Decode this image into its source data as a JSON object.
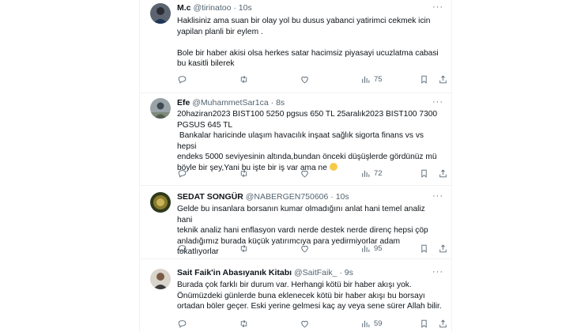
{
  "tweets": [
    {
      "name": "M.c",
      "handle": "@tirinatoo",
      "dot": "·",
      "time": "10s",
      "more": "···",
      "text": "Haklisiniz ama suan bir olay yol bu dusus yabanci yatirimci cekmek icin\nyapilan planli bir eylem .\n\nBole bir haber akisi olsa herkes satar hacimsiz piyasayi ucuzlatma cabasi\nbu kasitli bilerek",
      "views": "75"
    },
    {
      "name": "Efe",
      "handle": "@MuhammetSar1ca",
      "dot": "·",
      "time": "8s",
      "more": "···",
      "text": "20haziran2023 BIST100 5250 pgsus 650 TL 25aralık2023 BIST100 7300\nPGSUS 645 TL\n Bankalar haricinde ulaşım havacılık inşaat sağlık sigorta finans vs vs hepsi\nendeks 5000 seviyesinin altında,bundan önceki düşüşlerde gördünüz mü\nböyle bir şey,Yani bu işte bir iş var ama ne ",
      "views": "72"
    },
    {
      "name": "SEDAT SONGÜR",
      "handle": "@NABERGEN750606",
      "dot": "·",
      "time": "10s",
      "more": "···",
      "text": "Gelde bu insanlara borsanın kumar olmadığını anlat hani temel analiz hani\nteknik analiz hani enflasyon vardı nerde destek nerde direnç hepsi çöp\nanladığımız burada küçük yatırımcıya para yedirmiyorlar adam tokatlıyorlar",
      "views": "95"
    },
    {
      "name": "Sait Faik'in Abasıyanık Kitabı",
      "handle": "@SaitFaik_",
      "dot": "·",
      "time": "9s",
      "more": "···",
      "text": "Burada çok farklı bir durum var. Herhangi kötü bir haber akışı yok.\nÖnümüzdeki günlerde buna eklenecek kötü bir haber akışı bu borsayı\nortadan böler geçer. Eski yerine gelmesi kaç ay veya sene sürer Allah bilir.",
      "views": "59"
    }
  ],
  "icons": [
    "reply-icon",
    "retweet-icon",
    "like-icon",
    "views-icon",
    "bookmark-icon",
    "share-icon"
  ],
  "colors": {
    "text": "#0f1419",
    "secondary": "#536471",
    "divider": "#eff3f4"
  }
}
